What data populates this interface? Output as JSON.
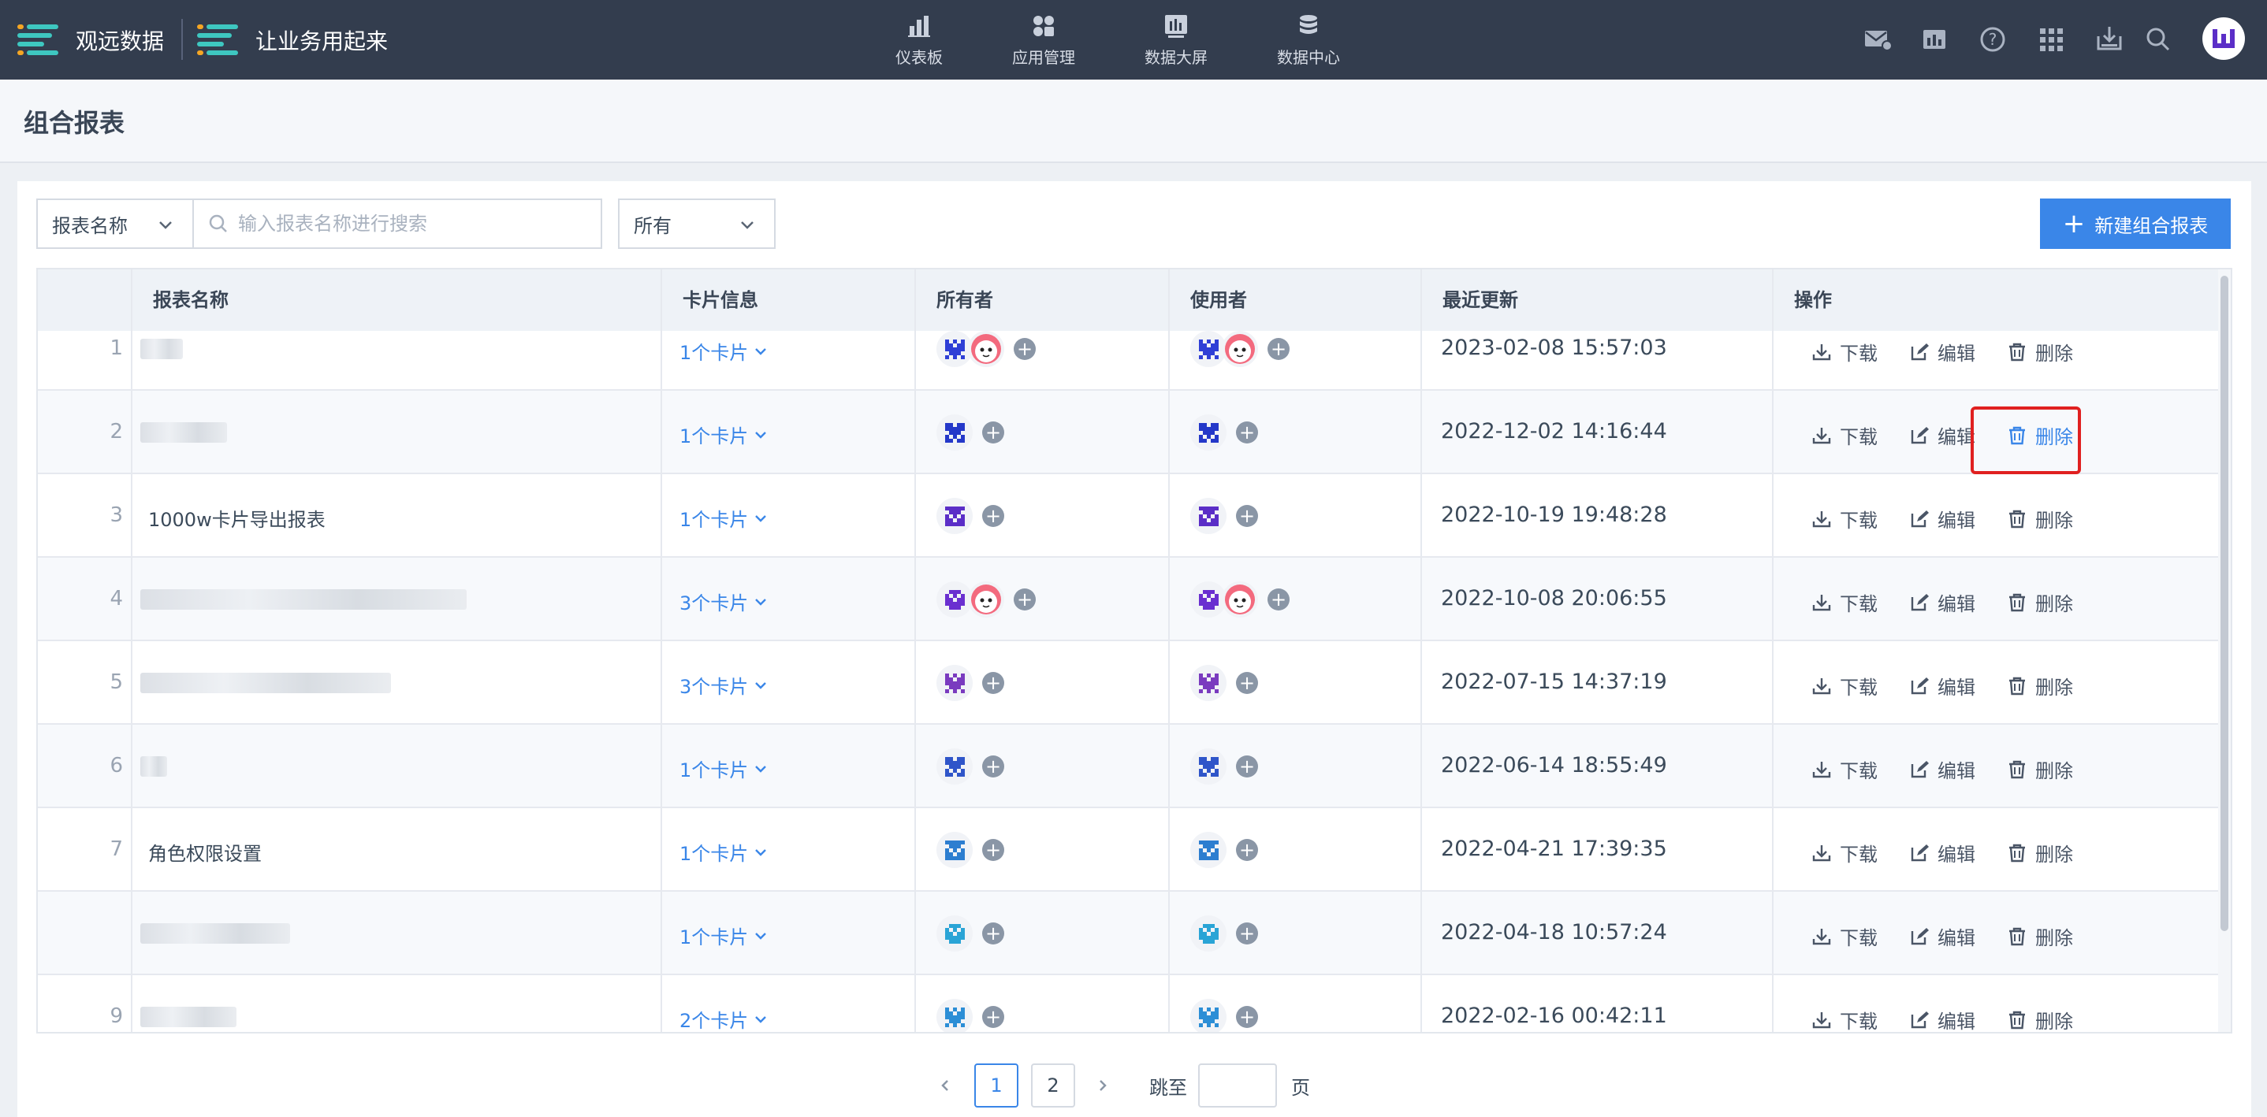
{
  "topbar": {
    "brand_name": "观远数据",
    "brand_slogan": "让业务用起来",
    "nav": [
      {
        "label": "仪表板",
        "icon": "bar-chart-icon"
      },
      {
        "label": "应用管理",
        "icon": "apps-grid-icon"
      },
      {
        "label": "数据大屏",
        "icon": "screen-chart-icon"
      },
      {
        "label": "数据中心",
        "icon": "database-icon"
      }
    ],
    "right_icons": [
      "mail-icon",
      "dashboard-icon",
      "help-icon",
      "app-grid-icon",
      "download-box-icon",
      "search-icon",
      "user-avatar"
    ]
  },
  "page": {
    "title": "组合报表"
  },
  "filters": {
    "field_select": "报表名称",
    "search_placeholder": "输入报表名称进行搜索",
    "owner_select": "所有",
    "new_button": "新建组合报表"
  },
  "table": {
    "columns": [
      "报表名称",
      "卡片信息",
      "所有者",
      "使用者",
      "最近更新",
      "操作"
    ],
    "actions": {
      "download": "下载",
      "edit": "编辑",
      "delete": "删除"
    },
    "rows": [
      {
        "index": "1",
        "name": "",
        "cards": "1个卡片",
        "updated": "2023-02-08 15:57:03"
      },
      {
        "index": "2",
        "name": "",
        "cards": "1个卡片",
        "updated": "2022-12-02 14:16:44"
      },
      {
        "index": "3",
        "name": "1000w卡片导出报表",
        "cards": "1个卡片",
        "updated": "2022-10-19 19:48:28"
      },
      {
        "index": "4",
        "name": "",
        "cards": "3个卡片",
        "updated": "2022-10-08 20:06:55"
      },
      {
        "index": "5",
        "name": "",
        "cards": "3个卡片",
        "updated": "2022-07-15 14:37:19"
      },
      {
        "index": "6",
        "name": "",
        "cards": "1个卡片",
        "updated": "2022-06-14 18:55:49"
      },
      {
        "index": "7",
        "name": "角色权限设置",
        "cards": "1个卡片",
        "updated": "2022-04-21 17:39:35"
      },
      {
        "index": "",
        "name": "",
        "cards": "1个卡片",
        "updated": "2022-04-18 10:57:24"
      },
      {
        "index": "9",
        "name": "",
        "cards": "2个卡片",
        "updated": "2022-02-16 00:42:11"
      }
    ]
  },
  "pagination": {
    "pages": [
      "1",
      "2"
    ],
    "current": "1",
    "jump_label": "跳至",
    "page_suffix": "页"
  },
  "colors": {
    "topbar": "#333d4e",
    "primary": "#3a86e8",
    "highlight": "#e02020"
  }
}
